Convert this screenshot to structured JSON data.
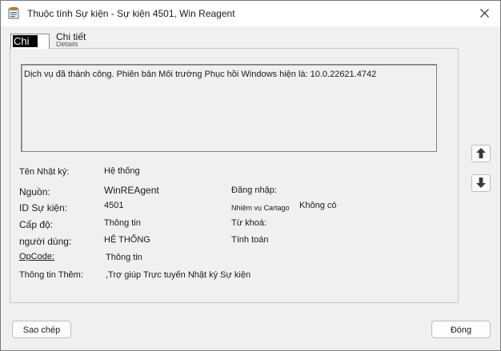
{
  "window": {
    "title": "Thuộc tính Sự kiện - Sự kiện 4501, Win Reagent",
    "close_glyph": "✕"
  },
  "tabs": [
    {
      "label": "Chi",
      "active": true
    },
    {
      "label": "Chi tiết",
      "sublabel": "Details",
      "active": false
    }
  ],
  "message": "Dịch vụ đã thành công. Phiên bản Môi trường Phục hồi Windows hiện là: 10.0.22621.4742",
  "fields": {
    "log_name_label": "Tên Nhật ký:",
    "log_name_value": "Hệ thống",
    "source_label": "Nguồn:",
    "source_value": "WinREAgent",
    "logged_label": "Đăng nhập:",
    "event_id_label": "ID Sự kiện:",
    "event_id_value": "4501",
    "task_category_label": "Nhiệm vụ Cartago",
    "task_category_value": "Không có",
    "level_label": "Cấp độ:",
    "level_value": "Thông tin",
    "keywords_label": "Từ khoá:",
    "user_label": "người dùng:",
    "user_value": "HỆ THỐNG",
    "computer_label": "Tính toán",
    "opcode_label": "OpCode:",
    "opcode_value": "Thông tin",
    "more_info_label": "Thông tin Thêm:",
    "more_info_value": ",Trợ giúp Trực tuyến Nhật ký Sự kiện"
  },
  "buttons": {
    "copy": "Sao chép",
    "close": "Đóng"
  },
  "colors": {
    "dialog_bg": "#f0f0f0",
    "titlebar_bg": "#ffffff",
    "active_tab_highlight": "#000000"
  },
  "icons": {
    "window": "event-viewer-icon",
    "up": "arrow-up-icon",
    "down": "arrow-down-icon"
  }
}
